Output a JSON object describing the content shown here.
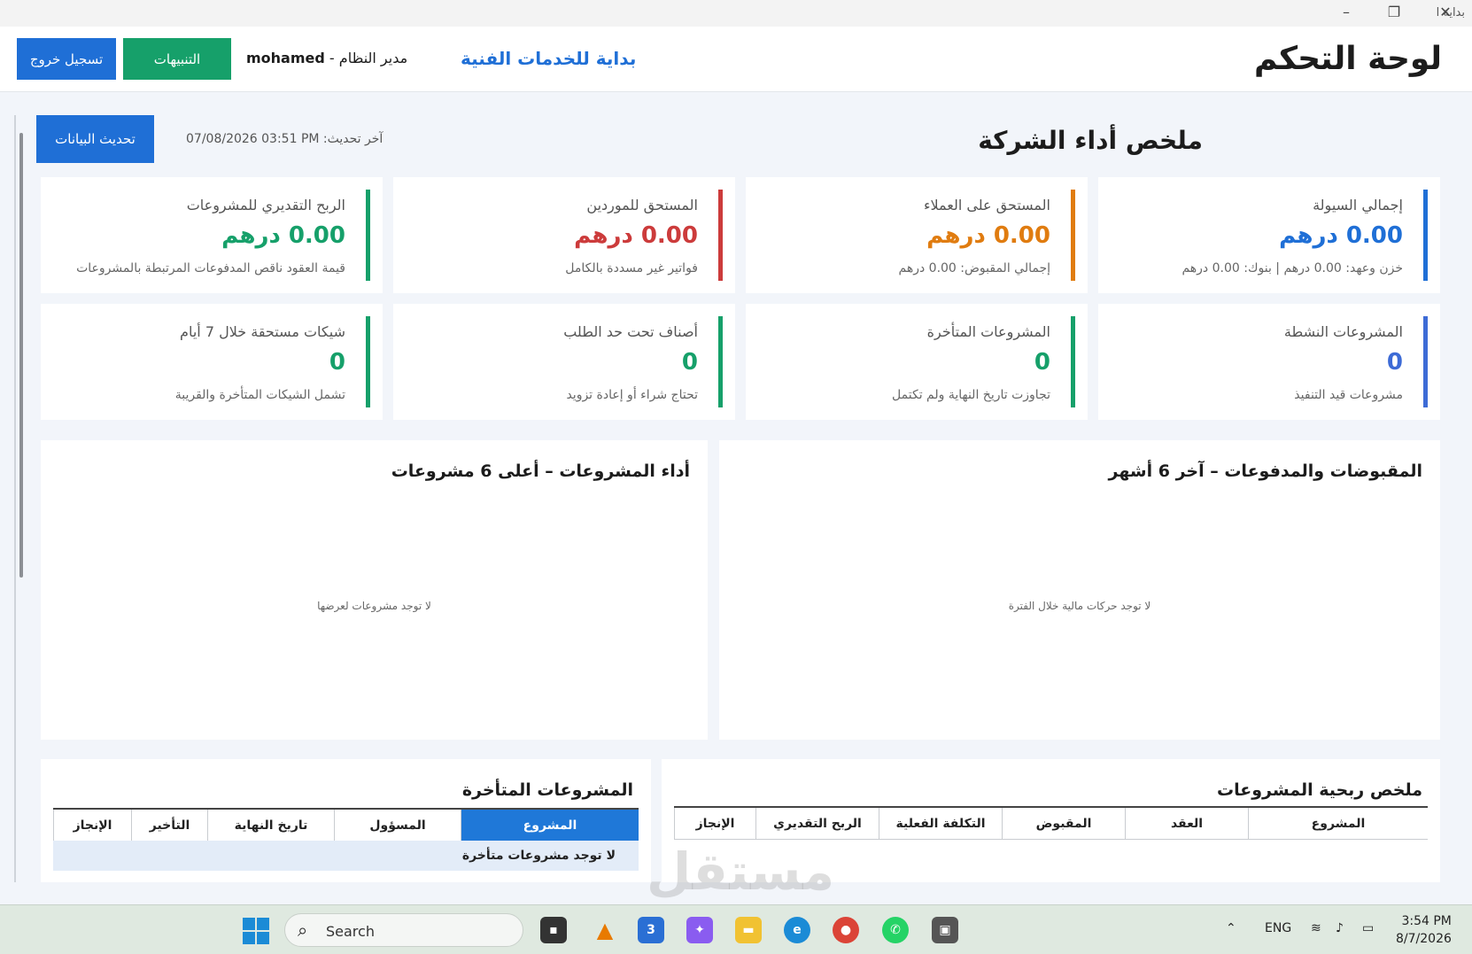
{
  "window": {
    "title": "بداية ا",
    "minimize": "–",
    "maximize": "❐",
    "close": "✕"
  },
  "header": {
    "app_title": "لوحة التحكم",
    "company": "بداية للخدمات الفنية",
    "user_role": "مدير النظام",
    "user_sep": " - ",
    "user_name": "mohamed",
    "alerts_label": "التنبيهات",
    "logout_label": "تسجيل خروج"
  },
  "summary": {
    "title": "ملخص أداء الشركة",
    "last_update_label": "آخر تحديث:",
    "last_update_value": "07/08/2026  03:51 PM",
    "refresh_label": "تحديث البيانات"
  },
  "cards": [
    {
      "label": "إجمالي السيولة",
      "value": "0.00 درهم",
      "sub": "خزن وعهد: 0.00 درهم  |  بنوك: 0.00 درهم",
      "color": "#1f6fd6"
    },
    {
      "label": "المستحق على العملاء",
      "value": "0.00 درهم",
      "sub": "إجمالي المقبوض: 0.00 درهم",
      "color": "#e07c10"
    },
    {
      "label": "المستحق للموردين",
      "value": "0.00 درهم",
      "sub": "فواتير غير مسددة بالكامل",
      "color": "#cc3b3b"
    },
    {
      "label": "الربح التقديري للمشروعات",
      "value": "0.00 درهم",
      "sub": "قيمة العقود ناقص المدفوعات المرتبطة بالمشروعات",
      "color": "#16a06a"
    },
    {
      "label": "المشروعات النشطة",
      "value": "0",
      "sub": "مشروعات قيد التنفيذ",
      "color": "#3d6bd6"
    },
    {
      "label": "المشروعات المتأخرة",
      "value": "0",
      "sub": "تجاوزت تاريخ النهاية ولم تكتمل",
      "color": "#16a06a"
    },
    {
      "label": "أصناف تحت حد الطلب",
      "value": "0",
      "sub": "تحتاج شراء أو إعادة تزويد",
      "color": "#16a06a"
    },
    {
      "label": "شيكات مستحقة خلال 7 أيام",
      "value": "0",
      "sub": "تشمل الشيكات المتأخرة والقريبة",
      "color": "#16a06a"
    }
  ],
  "charts": {
    "cashflow": {
      "title": "المقبوضات والمدفوعات – آخر 6 أشهر",
      "empty": "لا توجد حركات مالية خلال الفترة"
    },
    "projects": {
      "title": "أداء المشروعات – أعلى 6 مشروعات",
      "empty": "لا توجد مشروعات لعرضها"
    }
  },
  "profit_table": {
    "title": "ملخص ربحية المشروعات",
    "columns": [
      "المشروع",
      "العقد",
      "المقبوض",
      "التكلفة الفعلية",
      "الربح التقديري",
      "الإنجاز"
    ]
  },
  "late_table": {
    "title": "المشروعات المتأخرة",
    "columns": [
      "المشروع",
      "المسؤول",
      "تاريخ النهاية",
      "التأخير",
      "الإنجاز"
    ],
    "empty": "لا توجد مشروعات متأخرة"
  },
  "watermark": "مستقل",
  "taskbar": {
    "search_label": "Search",
    "language": "ENG",
    "time": "3:54 PM",
    "date": "8/7/2026"
  }
}
